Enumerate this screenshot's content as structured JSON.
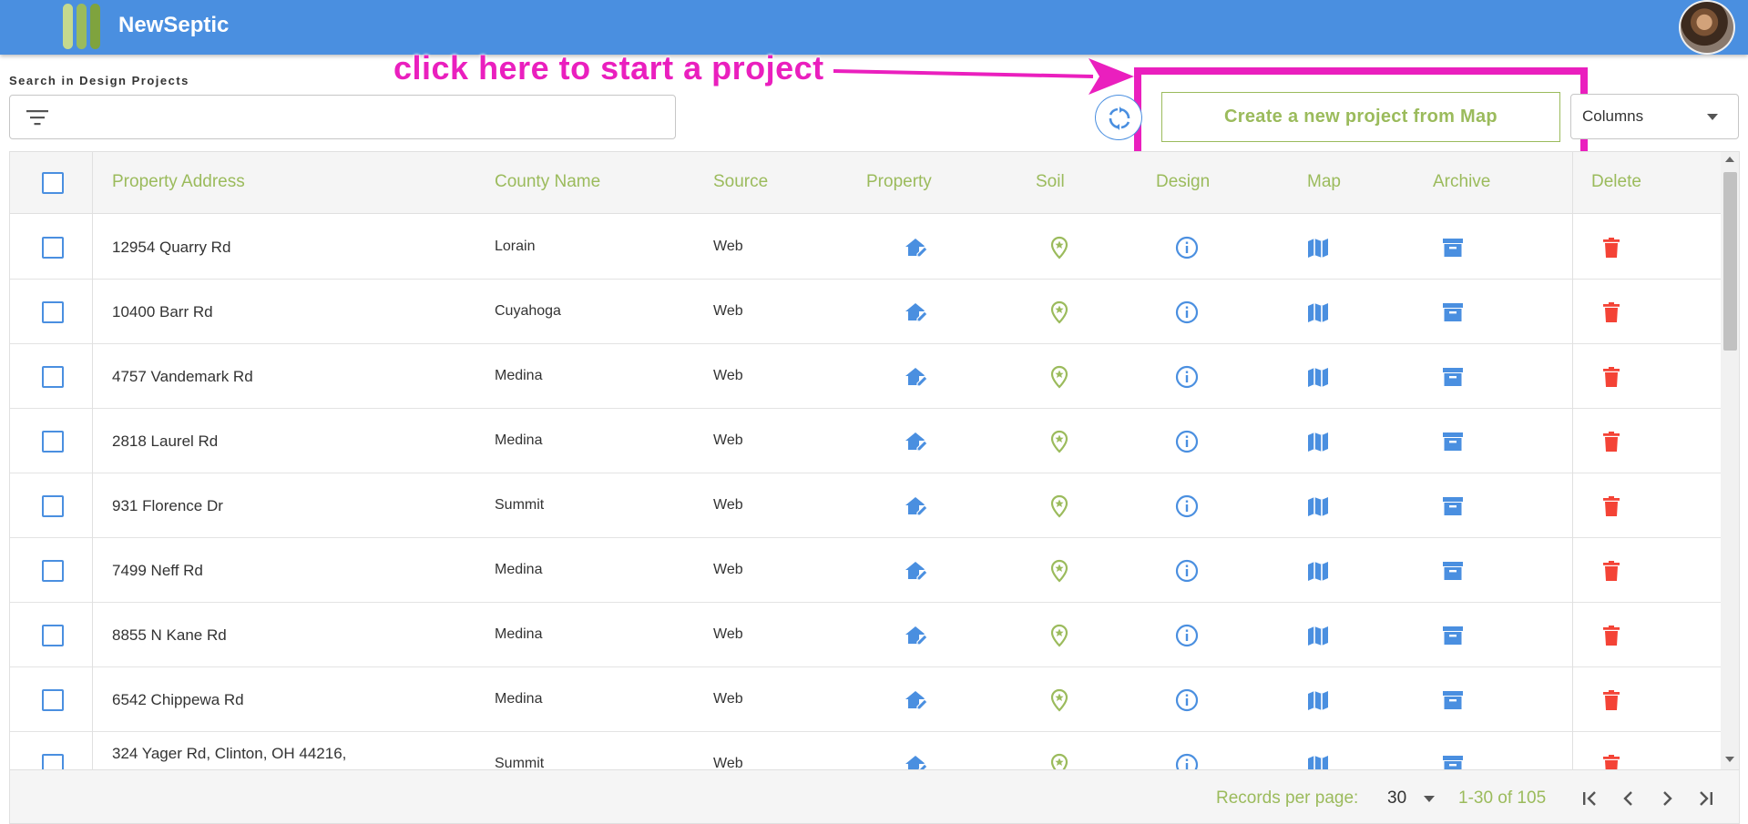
{
  "app": {
    "title": "NewSeptic",
    "brand_colors": [
      "#c5d98e",
      "#9bbb5c",
      "#7fa33e"
    ],
    "header_color": "#4a8fe0"
  },
  "annotation": {
    "text": "click here to start a project",
    "color": "#ea1fbe"
  },
  "search": {
    "label": "Search in Design Projects",
    "placeholder": "",
    "value": ""
  },
  "toolbar": {
    "refresh_icon": "refresh-icon",
    "create_label": "Create a new project from Map",
    "columns_label": "Columns"
  },
  "table": {
    "columns": [
      "Property Address",
      "County Name",
      "Source",
      "Property",
      "Soil",
      "Design",
      "Map",
      "Archive",
      "Delete"
    ],
    "rows": [
      {
        "address": "12954 Quarry Rd",
        "county": "Lorain",
        "source": "Web"
      },
      {
        "address": "10400 Barr Rd",
        "county": "Cuyahoga",
        "source": "Web"
      },
      {
        "address": "4757 Vandemark Rd",
        "county": "Medina",
        "source": "Web"
      },
      {
        "address": "2818 Laurel Rd",
        "county": "Medina",
        "source": "Web"
      },
      {
        "address": "931 Florence Dr",
        "county": "Summit",
        "source": "Web"
      },
      {
        "address": "7499 Neff Rd",
        "county": "Medina",
        "source": "Web"
      },
      {
        "address": "8855 N Kane Rd",
        "county": "Medina",
        "source": "Web"
      },
      {
        "address": "6542 Chippewa Rd",
        "county": "Medina",
        "source": "Web"
      },
      {
        "address": "324 Yager Rd, Clinton, OH 44216,",
        "county": "Summit",
        "source": "Web"
      }
    ],
    "row_icons": [
      "home-edit-icon",
      "map-pin-star-icon",
      "info-icon",
      "map-icon",
      "archive-icon",
      "trash-icon"
    ],
    "icon_colors": {
      "blue": "#4a8fe0",
      "green": "#9bbb5c",
      "red": "#f44336"
    }
  },
  "pagination": {
    "records_label": "Records per page:",
    "per_page": "30",
    "range": "1-30 of 105"
  }
}
